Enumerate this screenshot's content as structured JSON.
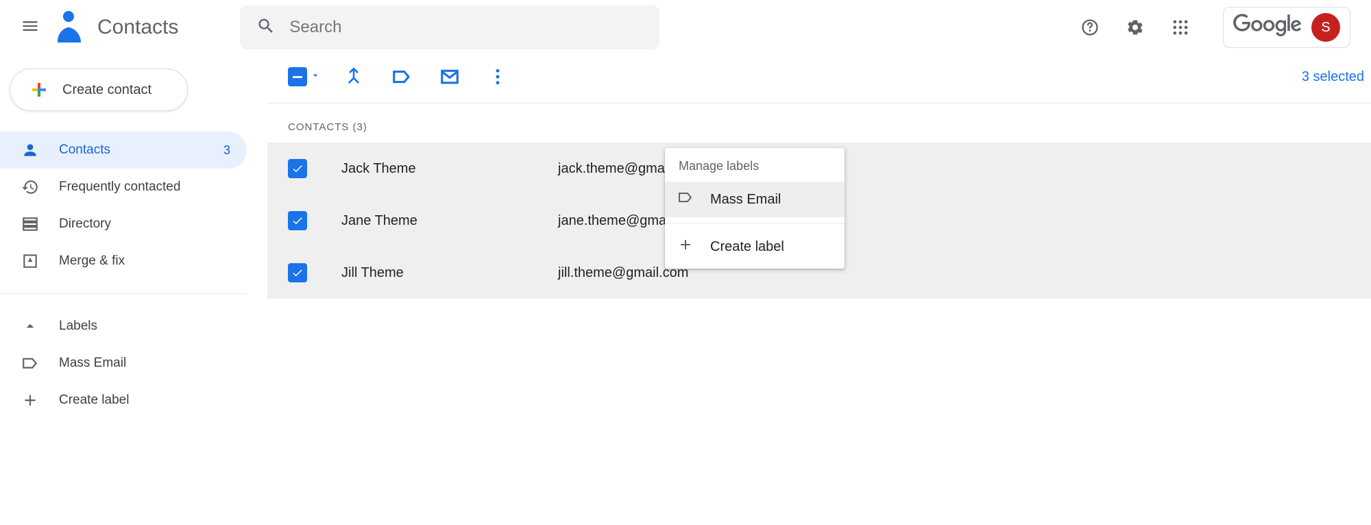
{
  "header": {
    "app_title": "Contacts",
    "search_placeholder": "Search",
    "avatar_initial": "S"
  },
  "sidebar": {
    "create_label": "Create contact",
    "items": [
      {
        "label": "Contacts",
        "count": "3"
      },
      {
        "label": "Frequently contacted"
      },
      {
        "label": "Directory"
      },
      {
        "label": "Merge & fix"
      }
    ],
    "labels_header": "Labels",
    "label_items": [
      {
        "label": "Mass Email"
      }
    ],
    "create_label_text": "Create label"
  },
  "toolbar": {
    "selected_text": "3 selected"
  },
  "contacts": {
    "section_title": "CONTACTS (3)",
    "rows": [
      {
        "name": "Jack Theme",
        "email": "jack.theme@gmail.com"
      },
      {
        "name": "Jane Theme",
        "email": "jane.theme@gmail.com"
      },
      {
        "name": "Jill Theme",
        "email": "jill.theme@gmail.com"
      }
    ]
  },
  "dropdown": {
    "title": "Manage labels",
    "items": [
      {
        "label": "Mass Email"
      }
    ],
    "create_label": "Create label"
  }
}
